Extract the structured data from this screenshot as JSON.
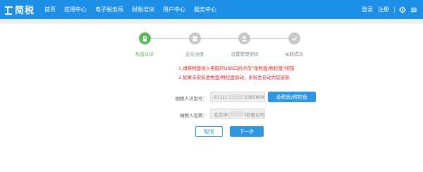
{
  "header": {
    "logo_text": "简税",
    "nav": [
      "首页",
      "应用中心",
      "电子税务局",
      "财税培训",
      "用户中心",
      "服务中心"
    ],
    "login": "登录",
    "register": "注册"
  },
  "steps": [
    {
      "label": "税盘认证",
      "active": true,
      "icon": "shield-icon"
    },
    {
      "label": "企业注册",
      "active": false,
      "icon": "building-icon"
    },
    {
      "label": "设置管理密码",
      "active": false,
      "icon": "user-icon"
    },
    {
      "label": "关联成功",
      "active": false,
      "icon": "check-icon"
    }
  ],
  "notes": [
    "1.请将税盘插入电脑的USB口后点击\"金税盘/税控盘\"按钮",
    "2.如果未安装金税盘/税控盘驱动，系统会自动为您安装"
  ],
  "form": {
    "tax_id_label": "纳税人识别号：",
    "tax_id_prefix": "9111(",
    "tax_id_suffix": "2285868",
    "tax_name_label": "纳税人名称：",
    "tax_name_prefix": "北京中(",
    "tax_name_suffix": "t有限公司",
    "detect_button": "金税盘/税控盘",
    "cancel_button": "取消",
    "next_button": "下一步"
  },
  "colors": {
    "header_bg": "#1e8fe6",
    "primary": "#2e95e3",
    "step_active": "#5cb85c",
    "step_inactive": "#c8c8c8",
    "note": "#e02020"
  }
}
